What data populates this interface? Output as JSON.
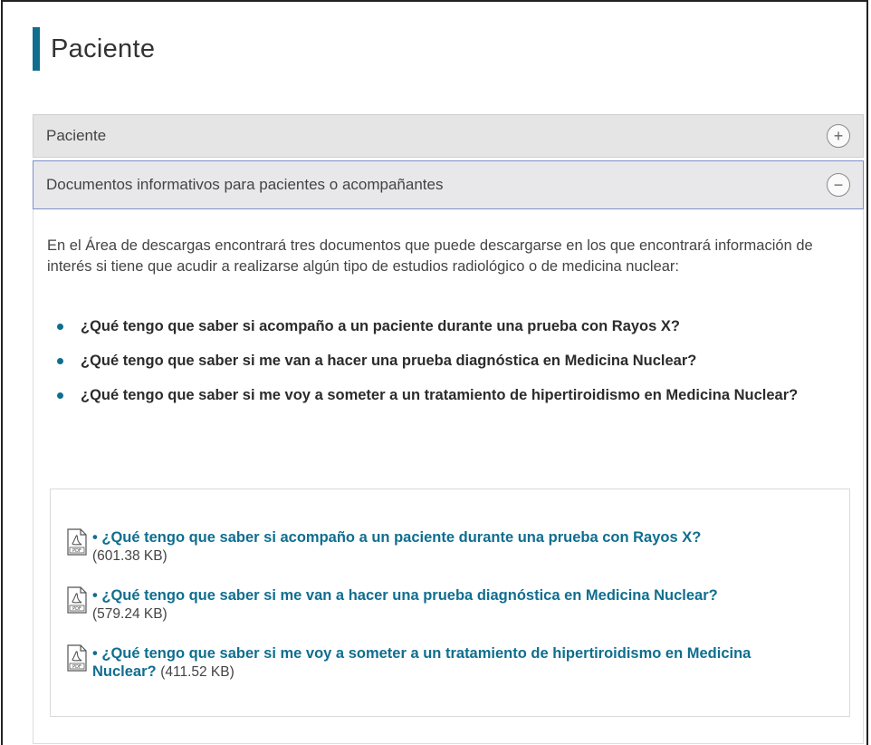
{
  "page": {
    "title": "Paciente"
  },
  "accordion": [
    {
      "label": "Paciente",
      "state": "collapsed",
      "toggle_symbol": "+"
    },
    {
      "label": "Documentos informativos para pacientes o acompañantes",
      "state": "expanded",
      "toggle_symbol": "−"
    }
  ],
  "content": {
    "intro": "En el Área de descargas  encontrará  tres documentos que puede descargarse  en los que encontrará información de interés si tiene que acudir  a realizarse algún tipo de estudios radiológico o de medicina nuclear:",
    "bullets": [
      "¿Qué tengo que saber si acompaño a un paciente durante una prueba con Rayos X?",
      "¿Qué tengo que saber si me van a hacer una prueba diagnóstica en Medicina Nuclear?",
      "¿Qué tengo que saber si me voy a someter a un tratamiento de hipertiroidismo en Medicina Nuclear?"
    ]
  },
  "downloads": [
    {
      "icon": "pdf-icon",
      "label": "• ¿Qué tengo que saber si acompaño a un paciente durante una prueba con Rayos X?",
      "size": "(601.38 KB)"
    },
    {
      "icon": "pdf-icon",
      "label": "• ¿Qué tengo que saber si me van a hacer una prueba diagnóstica en Medicina Nuclear?",
      "size": "(579.24 KB)"
    },
    {
      "icon": "pdf-icon",
      "label": "• ¿Qué tengo que saber si me voy a someter a un tratamiento de hipertiroidismo en Medicina Nuclear?",
      "size": "(411.52 KB)"
    }
  ],
  "colors": {
    "accent": "#0f6e8f",
    "header_bg": "#e5e5e5"
  }
}
